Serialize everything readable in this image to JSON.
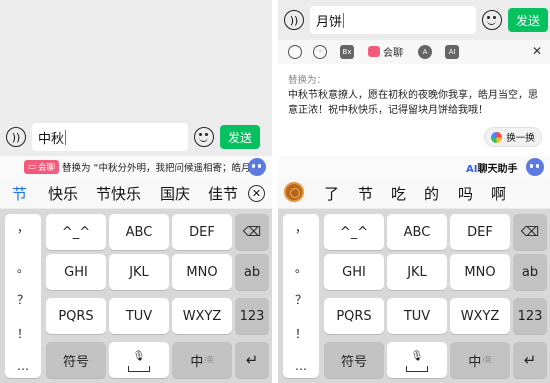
{
  "left": {
    "input": {
      "value": "中秋",
      "send_label": "发送"
    },
    "suggestion": {
      "tag": "会聊",
      "text": "替换为 “中秋分外明，我把问候遥相寄；皓月当",
      "tag_color": "#f25c7a"
    },
    "candidates": [
      "节",
      "快乐",
      "节快乐",
      "国庆",
      "佳节"
    ],
    "keys": {
      "punct": [
        "，",
        "。",
        "？",
        "！",
        "…"
      ],
      "row1": [
        "^_^",
        "ABC",
        "DEF"
      ],
      "row2": [
        "GHI",
        "JKL",
        "MNO"
      ],
      "row3": [
        "PQRS",
        "TUV",
        "WXYZ"
      ],
      "delete_icon": "backspace-icon",
      "ab": "ab",
      "num": "123",
      "symbol": "符号",
      "lang_main": "中",
      "lang_sub": "/英",
      "enter_icon": "return-icon"
    }
  },
  "right": {
    "input": {
      "value": "月饼",
      "send_label": "发送"
    },
    "toolbar": {
      "chat_label": "会聊",
      "icons": [
        "search-icon",
        "emoji-icon",
        "bubble-icon",
        "chat-icon",
        "a-icon",
        "ai-icon"
      ]
    },
    "card": {
      "head": "替换为：",
      "body": "中秋节秋意撩人，愿在初秋的夜晚你我享，皓月当空，思意正浓！祝中秋快乐，记得留块月饼给我哦！",
      "swap_label": "换一换"
    },
    "ai_helper": {
      "ai": "AI",
      "label": "聊天助手"
    },
    "candidates": [
      "了",
      "节",
      "吃",
      "的",
      "吗",
      "啊"
    ],
    "keys": {
      "punct": [
        "，",
        "。",
        "？",
        "！",
        "…"
      ],
      "row1": [
        "^_^",
        "ABC",
        "DEF"
      ],
      "row2": [
        "GHI",
        "JKL",
        "MNO"
      ],
      "row3": [
        "PQRS",
        "TUV",
        "WXYZ"
      ],
      "ab": "ab",
      "num": "123",
      "symbol": "符号",
      "lang_main": "中",
      "lang_sub": "/英"
    }
  },
  "colors": {
    "send": "#07c160",
    "accent_blue": "#1a73e8",
    "keyboard_bg": "#d8d8d8"
  }
}
